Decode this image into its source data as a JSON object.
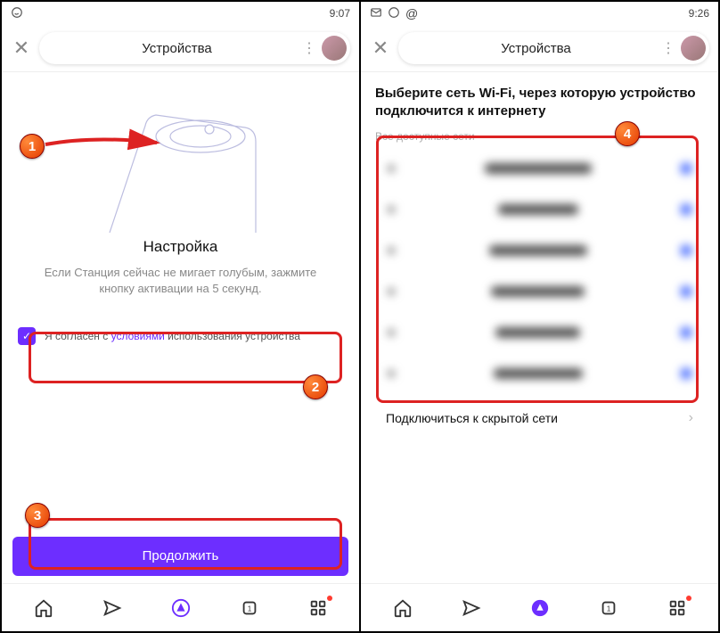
{
  "left": {
    "status_time": "9:07",
    "header_title": "Устройства",
    "setup_title": "Настройка",
    "setup_desc": "Если Станция сейчас не мигает голубым, зажмите кнопку активации на 5 секунд.",
    "consent_prefix": "Я согласен с ",
    "consent_link": "условиями",
    "consent_suffix": " использования устройства",
    "continue_label": "Продолжить"
  },
  "right": {
    "status_time": "9:26",
    "header_title": "Устройства",
    "wifi_heading": "Выберите сеть Wi-Fi, через которую устройство подключится к интернету",
    "wifi_sublabel": "Все доступные сети",
    "hidden_net_label": "Подключиться к скрытой сети"
  },
  "callouts": {
    "m1": "1",
    "m2": "2",
    "m3": "3",
    "m4": "4"
  }
}
